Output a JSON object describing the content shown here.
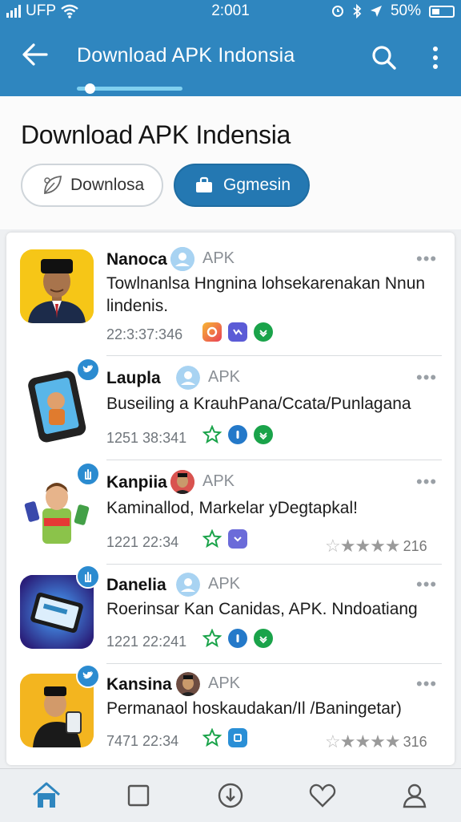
{
  "status_bar": {
    "carrier": "UFP",
    "time": "2:001",
    "battery": "50%"
  },
  "app_bar": {
    "title": "Download APK Indonsia"
  },
  "header": {
    "heading": "Download APK Indensia",
    "chips": [
      {
        "label": "Downlosa",
        "icon": "leaf-icon",
        "selected": false
      },
      {
        "label": "Ggmesin",
        "icon": "briefcase-icon",
        "selected": true
      }
    ]
  },
  "items": [
    {
      "name": "Nanoca",
      "tag": "APK",
      "desc": "Towlnanlsa Hngnina lohsekarenakan Nnun lindenis.",
      "time": "22:3:37:346",
      "thumb": "portrait-man-icon",
      "icons": [
        "ring-badge-icon",
        "check-square-icon",
        "check-circle-icon"
      ]
    },
    {
      "name": "Laupla",
      "tag": "APK",
      "desc": "Buseiling a KrauhPana/Ccata/Punlagana",
      "time": "1251 38:341",
      "thumb": "phone-icon",
      "icons": [
        "star-outline-icon",
        "info-circle-icon",
        "check-circle-icon"
      ]
    },
    {
      "name": "Kanpiia",
      "tag": "APK",
      "desc": "Kaminallod, Markelar yDegtapkal!",
      "time": "1221 22:34",
      "thumb": "boy-phones-icon",
      "icons": [
        "star-outline-icon",
        "chevron-square-icon"
      ],
      "rating_count": "216",
      "rating_value": 4
    },
    {
      "name": "Danelia",
      "tag": "APK",
      "desc": "Roerinsar Kan Canidas, APK. Nndoatiang",
      "time": "1221 22:241",
      "thumb": "tablet-icon",
      "icons": [
        "star-outline-icon",
        "info-circle-icon",
        "check-circle-icon"
      ]
    },
    {
      "name": "Kansina",
      "tag": "APK",
      "desc": "Permanaol hoskaudakan/Il /Baningetar)",
      "time": "7471 22:34",
      "thumb": "man-tablet-icon",
      "icons": [
        "star-outline-icon",
        "app-square-icon"
      ],
      "rating_count": "316",
      "rating_value": 4
    }
  ],
  "bottom_nav": [
    "home-icon",
    "square-icon",
    "download-icon",
    "heart-icon",
    "profile-icon"
  ],
  "colors": {
    "primary": "#2f86bf",
    "accent": "#2478b2",
    "green": "#1aa34a"
  }
}
